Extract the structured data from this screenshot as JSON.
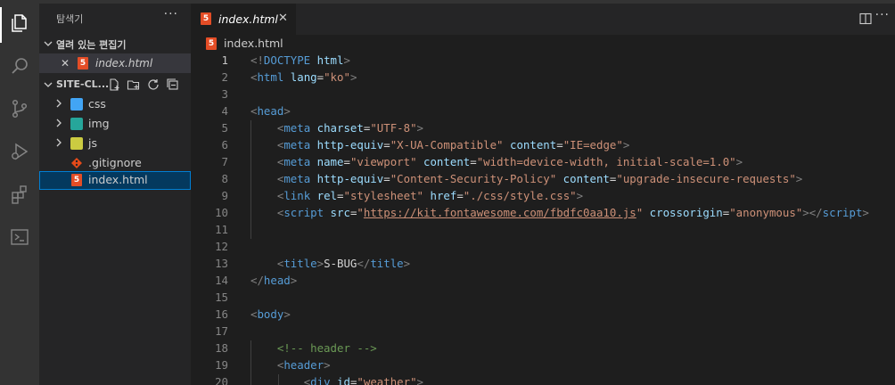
{
  "explorer": {
    "title": "탐색기",
    "more": "···",
    "open_editors_label": "열려 있는 편집기",
    "open_editor_file": "index.html",
    "open_editor_close": "✕",
    "workspace_label": "SITE-CL...",
    "tree": [
      {
        "name": "css",
        "kind": "folder",
        "icon_color": "#42a5f5"
      },
      {
        "name": "img",
        "kind": "folder",
        "icon_color": "#26a69a"
      },
      {
        "name": "js",
        "kind": "folder",
        "icon_color": "#cbcb41"
      },
      {
        "name": ".gitignore",
        "kind": "file",
        "icon_color": "#e64a19"
      },
      {
        "name": "index.html",
        "kind": "file",
        "icon_color": "#e44d26",
        "selected": true
      }
    ]
  },
  "activity_icons": [
    "files-icon",
    "search-icon",
    "source-control-icon",
    "run-debug-icon",
    "extensions-icon",
    "terminal-icon"
  ],
  "tab": {
    "label": "index.html",
    "close": "✕",
    "more": "···"
  },
  "breadcrumb": {
    "file": "index.html"
  },
  "html_badge": "5",
  "editor": {
    "active_line": 1,
    "lines": [
      {
        "n": "1",
        "tokens": [
          {
            "k": "p",
            "v": "<!"
          },
          {
            "k": "t",
            "v": "DOCTYPE"
          },
          {
            "k": "txt",
            "v": " "
          },
          {
            "k": "a",
            "v": "html"
          },
          {
            "k": "p",
            "v": ">"
          }
        ]
      },
      {
        "n": "2",
        "tokens": [
          {
            "k": "p",
            "v": "<"
          },
          {
            "k": "t",
            "v": "html"
          },
          {
            "k": "txt",
            "v": " "
          },
          {
            "k": "a",
            "v": "lang"
          },
          {
            "k": "txt",
            "v": "="
          },
          {
            "k": "s",
            "v": "\"ko\""
          },
          {
            "k": "p",
            "v": ">"
          }
        ]
      },
      {
        "n": "3",
        "tokens": []
      },
      {
        "n": "4",
        "tokens": [
          {
            "k": "p",
            "v": "<"
          },
          {
            "k": "t",
            "v": "head"
          },
          {
            "k": "p",
            "v": ">"
          }
        ]
      },
      {
        "n": "5",
        "tokens": [
          {
            "k": "txt",
            "v": "    "
          },
          {
            "k": "p",
            "v": "<"
          },
          {
            "k": "t",
            "v": "meta"
          },
          {
            "k": "txt",
            "v": " "
          },
          {
            "k": "a",
            "v": "charset"
          },
          {
            "k": "txt",
            "v": "="
          },
          {
            "k": "s",
            "v": "\"UTF-8\""
          },
          {
            "k": "p",
            "v": ">"
          }
        ]
      },
      {
        "n": "6",
        "tokens": [
          {
            "k": "txt",
            "v": "    "
          },
          {
            "k": "p",
            "v": "<"
          },
          {
            "k": "t",
            "v": "meta"
          },
          {
            "k": "txt",
            "v": " "
          },
          {
            "k": "a",
            "v": "http-equiv"
          },
          {
            "k": "txt",
            "v": "="
          },
          {
            "k": "s",
            "v": "\"X-UA-Compatible\""
          },
          {
            "k": "txt",
            "v": " "
          },
          {
            "k": "a",
            "v": "content"
          },
          {
            "k": "txt",
            "v": "="
          },
          {
            "k": "s",
            "v": "\"IE=edge\""
          },
          {
            "k": "p",
            "v": ">"
          }
        ]
      },
      {
        "n": "7",
        "tokens": [
          {
            "k": "txt",
            "v": "    "
          },
          {
            "k": "p",
            "v": "<"
          },
          {
            "k": "t",
            "v": "meta"
          },
          {
            "k": "txt",
            "v": " "
          },
          {
            "k": "a",
            "v": "name"
          },
          {
            "k": "txt",
            "v": "="
          },
          {
            "k": "s",
            "v": "\"viewport\""
          },
          {
            "k": "txt",
            "v": " "
          },
          {
            "k": "a",
            "v": "content"
          },
          {
            "k": "txt",
            "v": "="
          },
          {
            "k": "s",
            "v": "\"width=device-width, initial-scale=1.0\""
          },
          {
            "k": "p",
            "v": ">"
          }
        ]
      },
      {
        "n": "8",
        "tokens": [
          {
            "k": "txt",
            "v": "    "
          },
          {
            "k": "p",
            "v": "<"
          },
          {
            "k": "t",
            "v": "meta"
          },
          {
            "k": "txt",
            "v": " "
          },
          {
            "k": "a",
            "v": "http-equiv"
          },
          {
            "k": "txt",
            "v": "="
          },
          {
            "k": "s",
            "v": "\"Content-Security-Policy\""
          },
          {
            "k": "txt",
            "v": " "
          },
          {
            "k": "a",
            "v": "content"
          },
          {
            "k": "txt",
            "v": "="
          },
          {
            "k": "s",
            "v": "\"upgrade-insecure-requests\""
          },
          {
            "k": "p",
            "v": ">"
          }
        ]
      },
      {
        "n": "9",
        "tokens": [
          {
            "k": "txt",
            "v": "    "
          },
          {
            "k": "p",
            "v": "<"
          },
          {
            "k": "t",
            "v": "link"
          },
          {
            "k": "txt",
            "v": " "
          },
          {
            "k": "a",
            "v": "rel"
          },
          {
            "k": "txt",
            "v": "="
          },
          {
            "k": "s",
            "v": "\"stylesheet\""
          },
          {
            "k": "txt",
            "v": " "
          },
          {
            "k": "a",
            "v": "href"
          },
          {
            "k": "txt",
            "v": "="
          },
          {
            "k": "s",
            "v": "\"./css/style.css\""
          },
          {
            "k": "p",
            "v": ">"
          }
        ]
      },
      {
        "n": "10",
        "tokens": [
          {
            "k": "txt",
            "v": "    "
          },
          {
            "k": "p",
            "v": "<"
          },
          {
            "k": "t",
            "v": "script"
          },
          {
            "k": "txt",
            "v": " "
          },
          {
            "k": "a",
            "v": "src"
          },
          {
            "k": "txt",
            "v": "="
          },
          {
            "k": "s",
            "v": "\""
          },
          {
            "k": "u",
            "v": "https://kit.fontawesome.com/fbdfc0aa10.js"
          },
          {
            "k": "s",
            "v": "\""
          },
          {
            "k": "txt",
            "v": " "
          },
          {
            "k": "a",
            "v": "crossorigin"
          },
          {
            "k": "txt",
            "v": "="
          },
          {
            "k": "s",
            "v": "\"anonymous\""
          },
          {
            "k": "p",
            "v": "></"
          },
          {
            "k": "t",
            "v": "script"
          },
          {
            "k": "p",
            "v": ">"
          }
        ]
      },
      {
        "n": "11",
        "tokens": []
      },
      {
        "n": "12",
        "tokens": []
      },
      {
        "n": "13",
        "tokens": [
          {
            "k": "txt",
            "v": "    "
          },
          {
            "k": "p",
            "v": "<"
          },
          {
            "k": "t",
            "v": "title"
          },
          {
            "k": "p",
            "v": ">"
          },
          {
            "k": "txt",
            "v": "S-BUG"
          },
          {
            "k": "p",
            "v": "</"
          },
          {
            "k": "t",
            "v": "title"
          },
          {
            "k": "p",
            "v": ">"
          }
        ]
      },
      {
        "n": "14",
        "tokens": [
          {
            "k": "p",
            "v": "</"
          },
          {
            "k": "t",
            "v": "head"
          },
          {
            "k": "p",
            "v": ">"
          }
        ]
      },
      {
        "n": "15",
        "tokens": []
      },
      {
        "n": "16",
        "tokens": [
          {
            "k": "p",
            "v": "<"
          },
          {
            "k": "t",
            "v": "body"
          },
          {
            "k": "p",
            "v": ">"
          }
        ]
      },
      {
        "n": "17",
        "tokens": []
      },
      {
        "n": "18",
        "tokens": [
          {
            "k": "txt",
            "v": "    "
          },
          {
            "k": "c",
            "v": "<!-- header -->"
          }
        ]
      },
      {
        "n": "19",
        "tokens": [
          {
            "k": "txt",
            "v": "    "
          },
          {
            "k": "p",
            "v": "<"
          },
          {
            "k": "t",
            "v": "header"
          },
          {
            "k": "p",
            "v": ">"
          }
        ]
      },
      {
        "n": "20",
        "tokens": [
          {
            "k": "txt",
            "v": "        "
          },
          {
            "k": "p",
            "v": "<"
          },
          {
            "k": "t",
            "v": "div"
          },
          {
            "k": "txt",
            "v": " "
          },
          {
            "k": "a",
            "v": "id"
          },
          {
            "k": "txt",
            "v": "="
          },
          {
            "k": "s",
            "v": "\"weather\""
          },
          {
            "k": "p",
            "v": ">"
          }
        ]
      }
    ]
  }
}
